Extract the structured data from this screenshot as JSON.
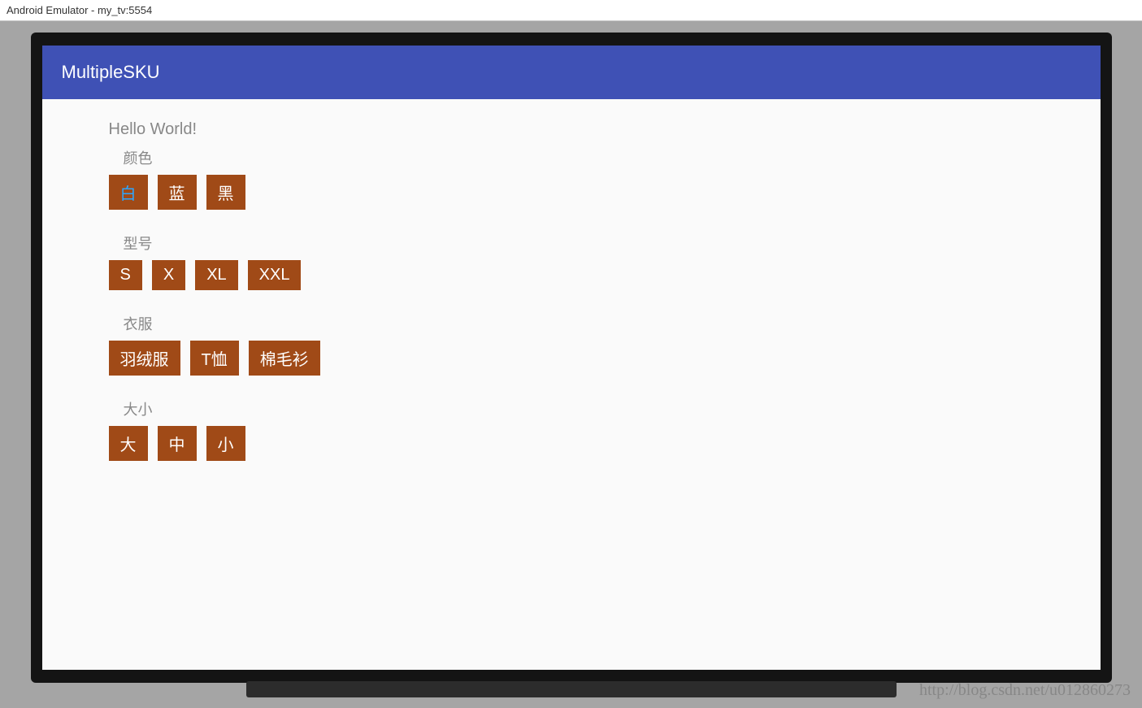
{
  "window": {
    "title": "Android Emulator - my_tv:5554"
  },
  "appbar": {
    "title": "MultipleSKU"
  },
  "content": {
    "greeting": "Hello World!",
    "groups": [
      {
        "label": "颜色",
        "options": [
          "白",
          "蓝",
          "黑"
        ],
        "selected_index": 0
      },
      {
        "label": "型号",
        "options": [
          "S",
          "X",
          "XL",
          "XXL"
        ],
        "selected_index": -1
      },
      {
        "label": "衣服",
        "options": [
          "羽绒服",
          "T恤",
          "棉毛衫"
        ],
        "selected_index": -1
      },
      {
        "label": "大小",
        "options": [
          "大",
          "中",
          "小"
        ],
        "selected_index": -1
      }
    ]
  },
  "watermark": "http://blog.csdn.net/u012860273"
}
